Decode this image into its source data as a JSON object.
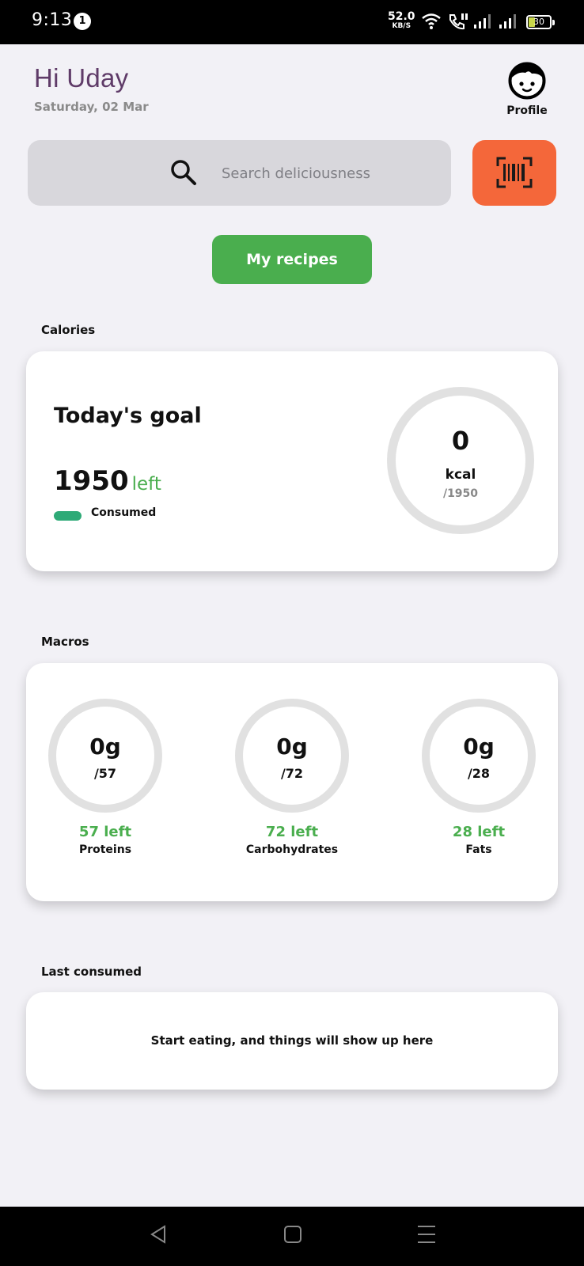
{
  "status_bar": {
    "time": "9:13",
    "notification_count": "1",
    "net_speed": "52.0",
    "net_unit": "KB/S",
    "battery": "30",
    "icons": [
      "wifi-icon",
      "call-icon",
      "signal-icon",
      "signal-icon",
      "battery-icon"
    ]
  },
  "header": {
    "greeting": "Hi Uday",
    "date": "Saturday, 02 Mar",
    "profile_label": "Profile"
  },
  "search": {
    "placeholder": "Search deliciousness"
  },
  "buttons": {
    "my_recipes": "My recipes"
  },
  "calories": {
    "section_title": "Calories",
    "card_title": "Today's goal",
    "left_value": "1950",
    "left_word": "left",
    "legend_label": "Consumed",
    "consumed": "0",
    "unit": "kcal",
    "goal": "/1950",
    "consumed_fraction": 0
  },
  "macros": {
    "section_title": "Macros",
    "items": [
      {
        "value": "0g",
        "goal": "/57",
        "left": "57 left",
        "name": "Proteins"
      },
      {
        "value": "0g",
        "goal": "/72",
        "left": "72 left",
        "name": "Carbohydrates"
      },
      {
        "value": "0g",
        "goal": "/28",
        "left": "28 left",
        "name": "Fats"
      }
    ]
  },
  "last_consumed": {
    "section_title": "Last consumed",
    "empty_message": "Start eating, and things will show up here"
  },
  "colors": {
    "accent_green": "#4aae4e",
    "scan_orange": "#f4673a",
    "greeting_purple": "#5f3b68",
    "consumed_legend": "#2eaa77"
  }
}
